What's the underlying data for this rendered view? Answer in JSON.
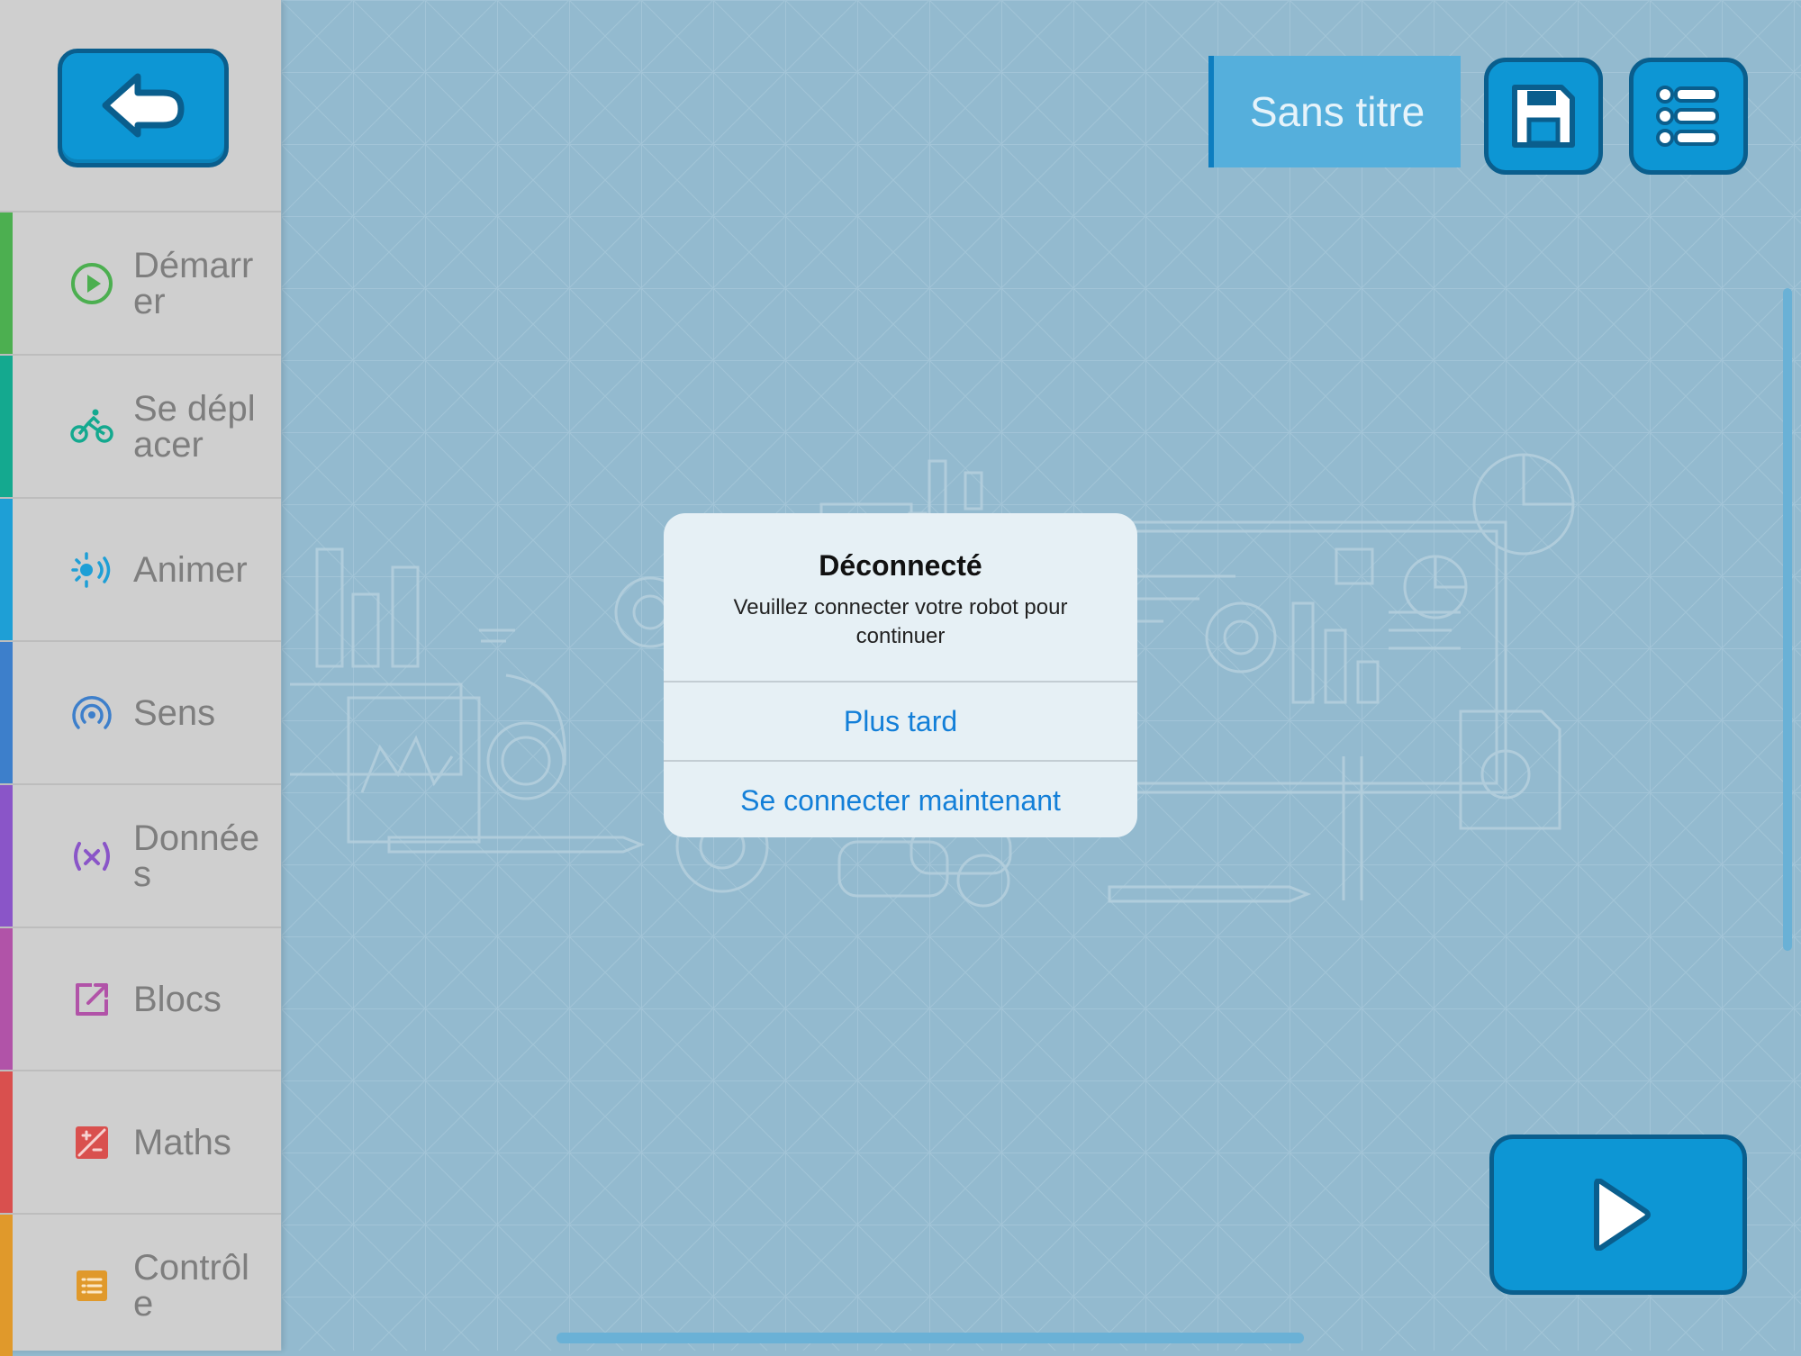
{
  "app": {
    "project_title": "Sans titre"
  },
  "sidebar": {
    "items": [
      {
        "label": "Démarrer",
        "icon": "play-circle-icon",
        "color": "#4caf50"
      },
      {
        "label": "Se déplacer",
        "icon": "bicycle-icon",
        "color": "#14a98f"
      },
      {
        "label": "Animer",
        "icon": "light-sound-icon",
        "color": "#1e9fd6"
      },
      {
        "label": "Sens",
        "icon": "sensor-signal-icon",
        "color": "#3d7fcb"
      },
      {
        "label": "Données",
        "icon": "variable-icon",
        "color": "#8a55c8"
      },
      {
        "label": "Blocs",
        "icon": "external-link-icon",
        "color": "#b153a8"
      },
      {
        "label": "Maths",
        "icon": "plus-minus-icon",
        "color": "#d9504e"
      },
      {
        "label": "Contrôle",
        "icon": "list-icon",
        "color": "#e0992b"
      }
    ]
  },
  "dialog": {
    "title": "Déconnecté",
    "message": "Veuillez connecter votre robot pour continuer",
    "later_label": "Plus tard",
    "connect_label": "Se connecter maintenant"
  },
  "colors": {
    "accent": "#0d96d4",
    "accent_border": "#0a5e8d",
    "canvas_bg": "#93bacf",
    "link": "#137fd8"
  }
}
